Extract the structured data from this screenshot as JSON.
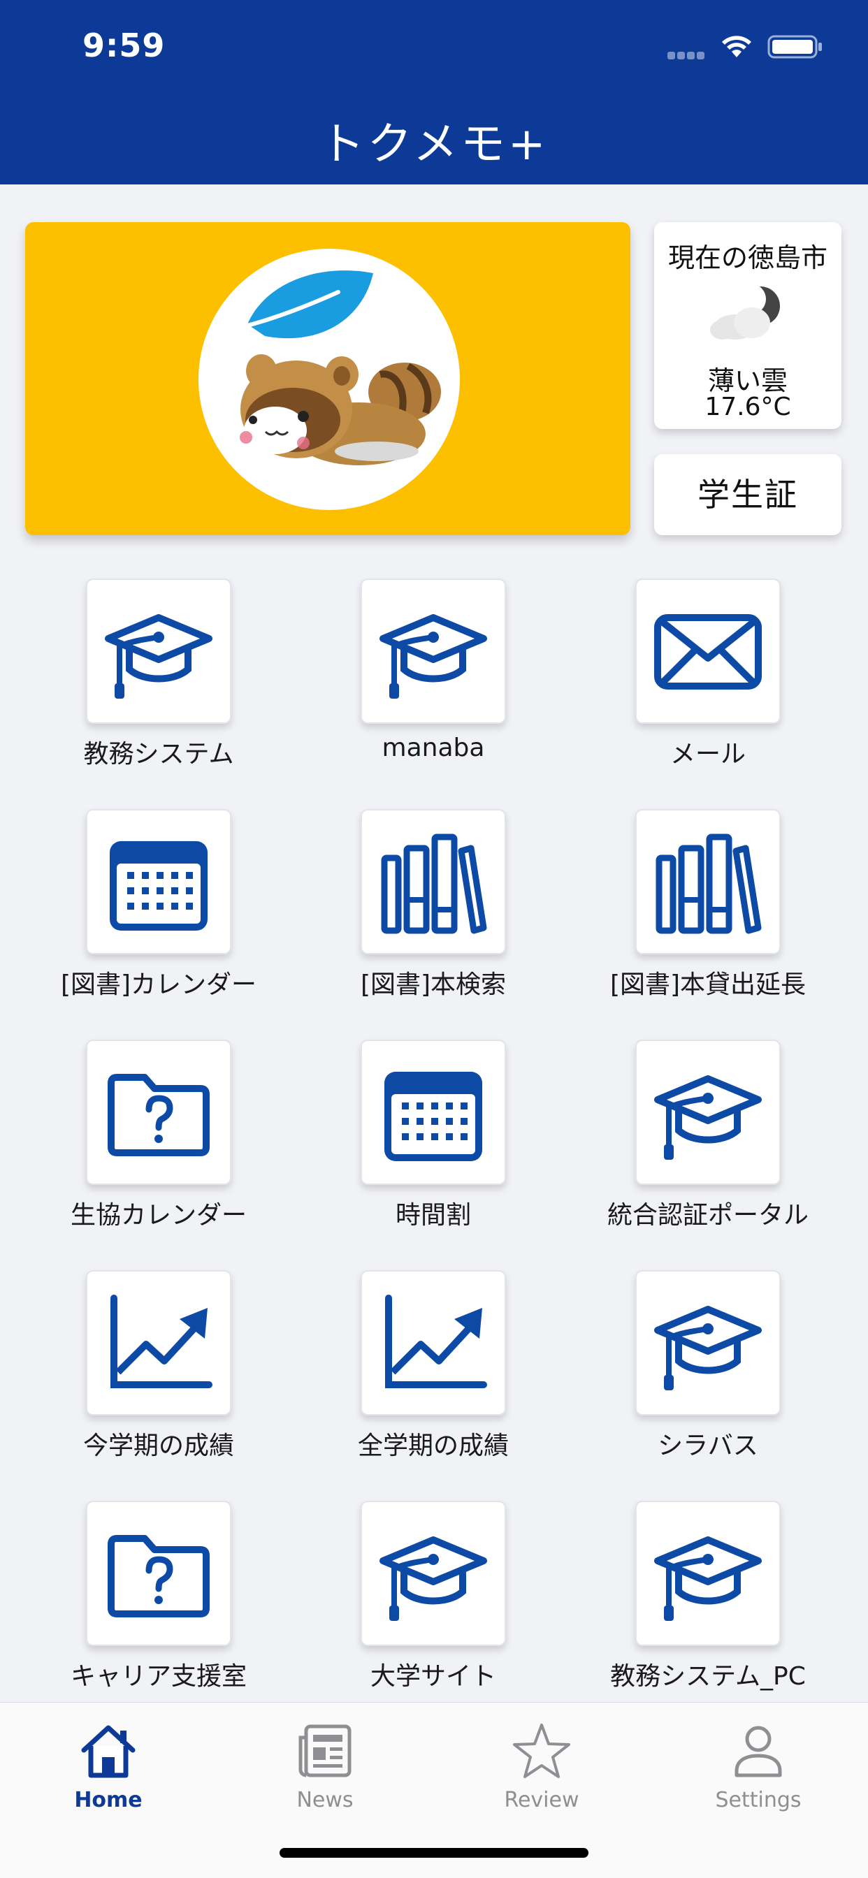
{
  "status_bar": {
    "time": "9:59"
  },
  "header": {
    "title": "トクメモ+"
  },
  "weather": {
    "city": "現在の徳島市",
    "description": "薄い雲",
    "temperature": "17.6°C"
  },
  "student_id_label": "学生証",
  "tiles": [
    {
      "label": "教務システム",
      "icon": "graduation-cap-icon"
    },
    {
      "label": "manaba",
      "icon": "graduation-cap-icon"
    },
    {
      "label": "メール",
      "icon": "envelope-icon"
    },
    {
      "label": "[図書]カレンダー",
      "icon": "calendar-icon"
    },
    {
      "label": "[図書]本検索",
      "icon": "books-icon"
    },
    {
      "label": "[図書]本貸出延長",
      "icon": "books-icon"
    },
    {
      "label": "生協カレンダー",
      "icon": "folder-question-icon"
    },
    {
      "label": "時間割",
      "icon": "calendar-icon"
    },
    {
      "label": "統合認証ポータル",
      "icon": "graduation-cap-icon"
    },
    {
      "label": "今学期の成績",
      "icon": "chart-up-icon"
    },
    {
      "label": "全学期の成績",
      "icon": "chart-up-icon"
    },
    {
      "label": "シラバス",
      "icon": "graduation-cap-icon"
    },
    {
      "label": "キャリア支援室",
      "icon": "folder-question-icon"
    },
    {
      "label": "大学サイト",
      "icon": "graduation-cap-icon"
    },
    {
      "label": "教務システム_PC",
      "icon": "graduation-cap-icon"
    }
  ],
  "tabbar": {
    "tabs": [
      {
        "label": "Home",
        "icon": "home-icon",
        "active": true
      },
      {
        "label": "News",
        "icon": "newspaper-icon",
        "active": false
      },
      {
        "label": "Review",
        "icon": "star-icon",
        "active": false
      },
      {
        "label": "Settings",
        "icon": "person-icon",
        "active": false
      }
    ]
  },
  "colors": {
    "brand_blue": "#0c3a96",
    "icon_blue": "#0d4aa6",
    "banner_yellow": "#fdc000",
    "background": "#f1f2f6",
    "tab_inactive": "#8e8e93"
  }
}
